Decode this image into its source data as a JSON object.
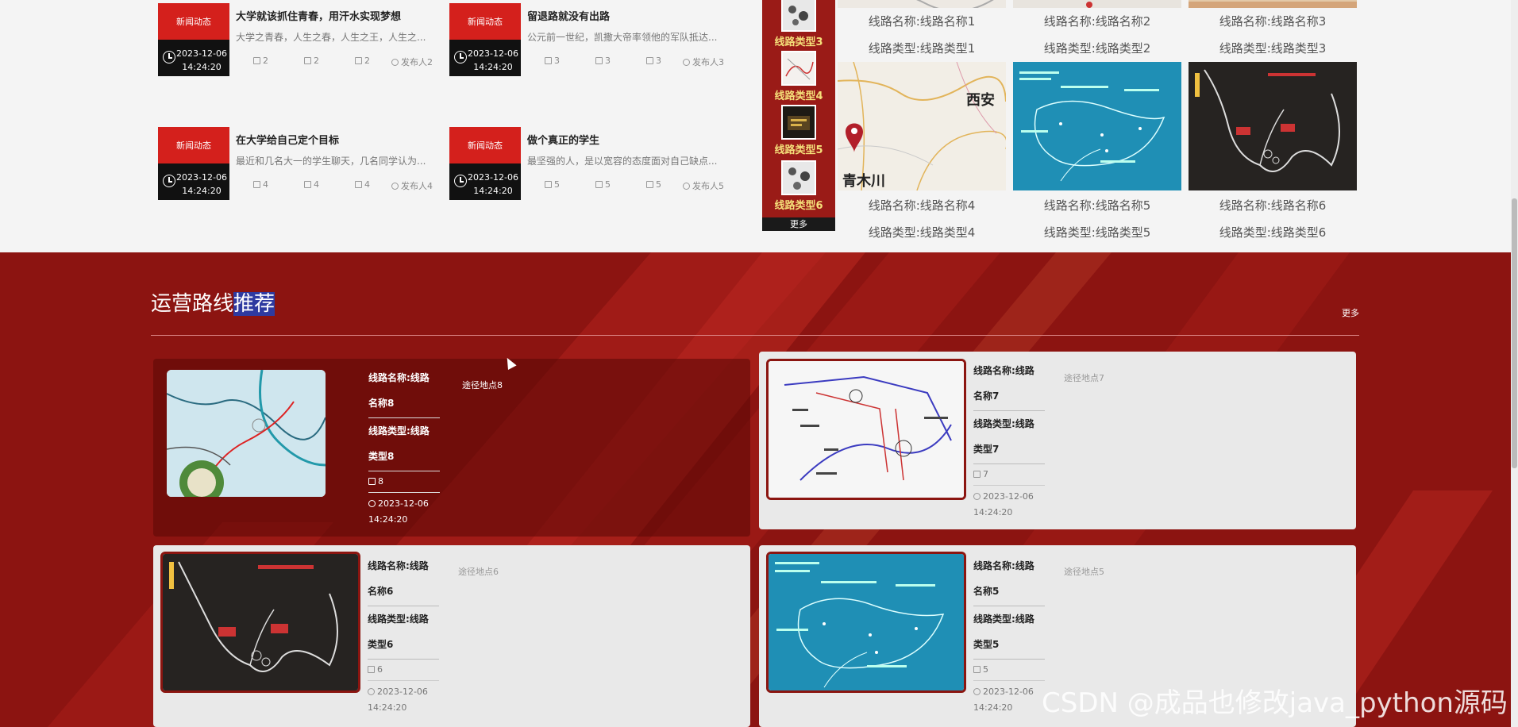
{
  "news": [
    {
      "tag": "新闻动态",
      "date": "2023-12-06",
      "time": "14:24:20",
      "title": "大学就该抓住青春，用汗水实现梦想",
      "desc": "大学之青春，人生之春，人生之王，人生之...",
      "likes": "2",
      "comments": "2",
      "favorites": "2",
      "author": "发布人2"
    },
    {
      "tag": "新闻动态",
      "date": "2023-12-06",
      "time": "14:24:20",
      "title": "留退路就没有出路",
      "desc": "公元前一世纪，凯撒大帝率领他的军队抵达...",
      "likes": "3",
      "comments": "3",
      "favorites": "3",
      "author": "发布人3"
    },
    {
      "tag": "新闻动态",
      "date": "2023-12-06",
      "time": "14:24:20",
      "title": "在大学给自己定个目标",
      "desc": "最近和几名大一的学生聊天，几名同学认为...",
      "likes": "4",
      "comments": "4",
      "favorites": "4",
      "author": "发布人4"
    },
    {
      "tag": "新闻动态",
      "date": "2023-12-06",
      "time": "14:24:20",
      "title": "做个真正的学生",
      "desc": "最坚强的人，是以宽容的态度面对自己缺点...",
      "likes": "5",
      "comments": "5",
      "favorites": "5",
      "author": "发布人5"
    }
  ],
  "route_types_sidebar": {
    "items": [
      "线路类型3",
      "线路类型4",
      "线路类型5",
      "线路类型6"
    ],
    "more": "更多"
  },
  "route_tiles": [
    {
      "name": "线路名称:线路名称1",
      "type": "线路类型:线路类型1"
    },
    {
      "name": "线路名称:线路名称2",
      "type": "线路类型:线路类型2"
    },
    {
      "name": "线路名称:线路名称3",
      "type": "线路类型:线路类型3"
    },
    {
      "name": "线路名称:线路名称4",
      "type": "线路类型:线路类型4",
      "map_labels": [
        "西安",
        "青木川"
      ]
    },
    {
      "name": "线路名称:线路名称5",
      "type": "线路类型:线路类型5"
    },
    {
      "name": "线路名称:线路名称6",
      "type": "线路类型:线路类型6"
    }
  ],
  "recommend": {
    "title_plain": "运营路线",
    "title_highlight": "推荐",
    "more": "更多",
    "cards": [
      {
        "name_l1": "线路名称:线路",
        "name_l2": "名称8",
        "type_l1": "线路类型:线路",
        "type_l2": "类型8",
        "count": "8",
        "date": "2023-12-06",
        "time": "14:24:20",
        "stop": "途径地点8"
      },
      {
        "name_l1": "线路名称:线路",
        "name_l2": "名称7",
        "type_l1": "线路类型:线路",
        "type_l2": "类型7",
        "count": "7",
        "date": "2023-12-06",
        "time": "14:24:20",
        "stop": "途径地点7"
      },
      {
        "name_l1": "线路名称:线路",
        "name_l2": "名称6",
        "type_l1": "线路类型:线路",
        "type_l2": "类型6",
        "count": "6",
        "date": "2023-12-06",
        "time": "14:24:20",
        "stop": "途径地点6"
      },
      {
        "name_l1": "线路名称:线路",
        "name_l2": "名称5",
        "type_l1": "线路类型:线路",
        "type_l2": "类型5",
        "count": "5",
        "date": "2023-12-06",
        "time": "14:24:20",
        "stop": "途径地点5"
      }
    ]
  },
  "watermark": "CSDN @成品也修改java_python源码"
}
